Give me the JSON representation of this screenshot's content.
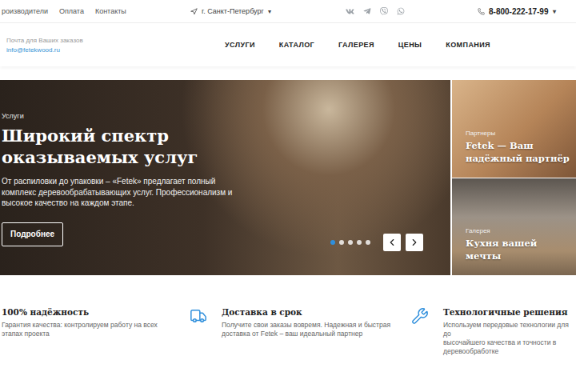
{
  "top_bar": {
    "links": [
      "роизводители",
      "Оплата",
      "Контакты"
    ],
    "city": "г. Санкт-Петербург",
    "city_caret": "▾",
    "phone": "8-800-222-17-99",
    "phone_caret": "▾"
  },
  "header": {
    "mail_label": "Почта для Ваших заказов",
    "mail": "info@fetekwood.ru",
    "nav": [
      "УСЛУГИ",
      "КАТАЛОГ",
      "ГАЛЕРЕЯ",
      "ЦЕНЫ",
      "КОМПАНИЯ"
    ]
  },
  "hero": {
    "tag": "Услуги",
    "title_lines": [
      "Широкий спектр",
      "оказываемых услуг"
    ],
    "text_lines": [
      "От распиловки до упаковки – «Fetek» предлагает полный",
      "комплекс деревообрабатывающих услуг. Профессионализм и",
      "высокое качество на каждом этапе."
    ],
    "button": "Подробнее",
    "slides": [
      {
        "selected": true
      },
      {
        "selected": false
      },
      {
        "selected": false
      },
      {
        "selected": false
      },
      {
        "selected": false
      }
    ]
  },
  "side_cards": [
    {
      "tag": "Партнеры",
      "title": "Fetek — Ваш надёжный партнёр",
      "kind": "wood"
    },
    {
      "tag": "Галерея",
      "title": "Кухня вашей мечты",
      "kind": "kitchen"
    }
  ],
  "features": [
    {
      "kind": "plain",
      "title": "100% надёжность",
      "lines": [
        "Гарантия качества: контролируем работу на всех",
        "этапах проекта"
      ]
    },
    {
      "kind": "delivery",
      "title": "Доставка в срок",
      "lines": [
        "Получите свои заказы вовремя. Надежная и быстрая",
        "доставка от Fetek – ваш идеальный партнер"
      ]
    },
    {
      "kind": "tech",
      "title": "Технологичные решения",
      "lines": [
        "Используем передовые технологии для до",
        "высочайшего качества и точности в",
        "деревообработке"
      ]
    }
  ]
}
